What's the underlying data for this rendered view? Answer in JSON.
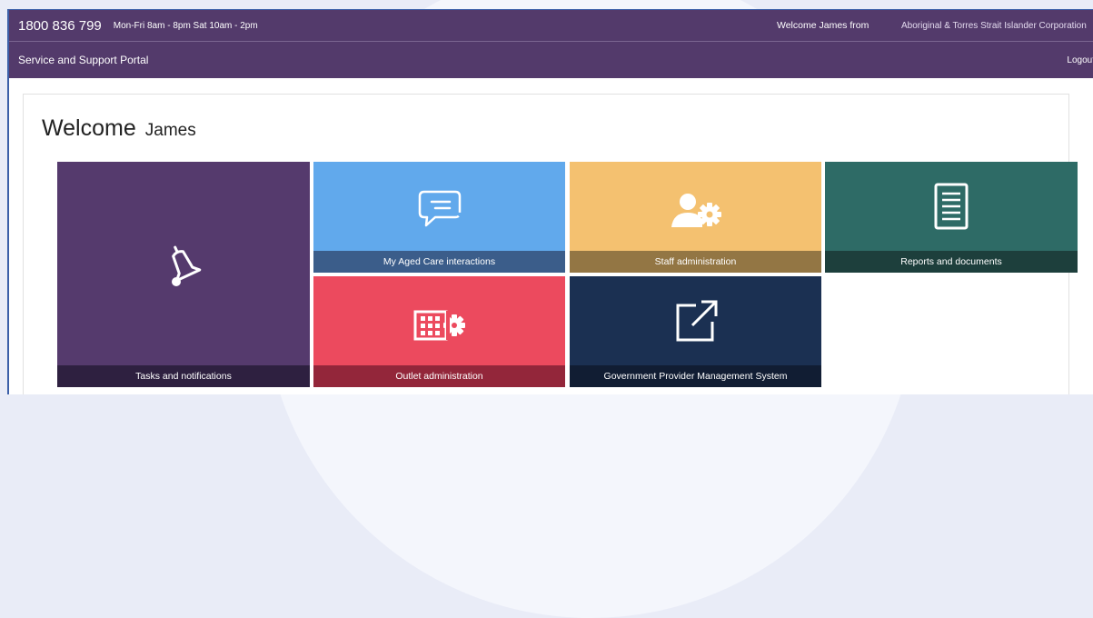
{
  "header": {
    "phone": "1800 836 799",
    "hours": "Mon-Fri 8am - 8pm Sat 10am - 2pm",
    "welcome": "Welcome  James from",
    "organisation": "Aboriginal & Torres Strait Islander Corporation",
    "portal_title": "Service and Support Portal",
    "logout_label": "Logout"
  },
  "main": {
    "welcome_word": "Welcome",
    "user_name": "James"
  },
  "tiles": [
    {
      "label": "Tasks and notifications",
      "icon": "bell-icon",
      "color": "#553a6d"
    },
    {
      "label": "My Aged Care interactions",
      "icon": "chat-icon",
      "color": "#61a9ec"
    },
    {
      "label": "Staff administration",
      "icon": "user-gear-icon",
      "color": "#f4c170"
    },
    {
      "label": "Reports and documents",
      "icon": "document-icon",
      "color": "#2e6b66"
    },
    {
      "label": "Outlet administration",
      "icon": "building-gear-icon",
      "color": "#ec4a5e"
    },
    {
      "label": "Government Provider Management System",
      "icon": "external-link-icon",
      "color": "#1b3052"
    }
  ],
  "colors": {
    "header_bg": "#533a6b",
    "page_bg": "#e9ecf7"
  }
}
